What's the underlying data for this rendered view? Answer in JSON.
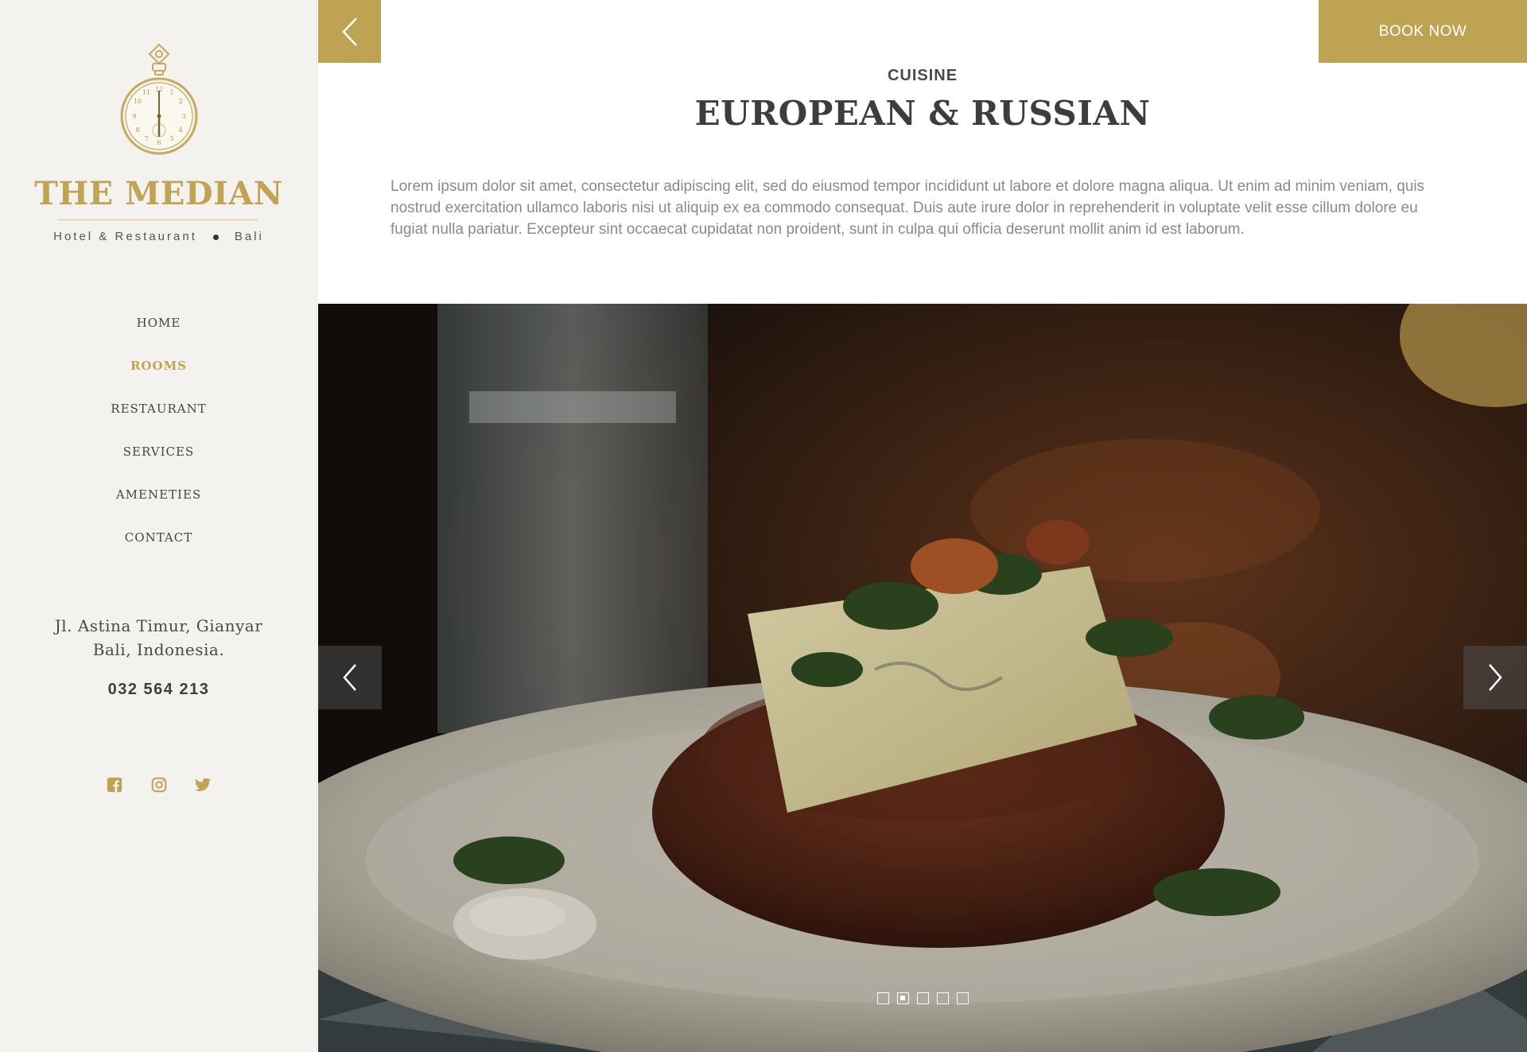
{
  "brand": {
    "name": "THE MEDIAN",
    "tagline_left": "Hotel & Restaurant",
    "tagline_right": "Bali"
  },
  "nav": {
    "items": [
      {
        "label": "HOME",
        "active": false
      },
      {
        "label": "ROOMS",
        "active": true
      },
      {
        "label": "RESTAURANT",
        "active": false
      },
      {
        "label": "SERVICES",
        "active": false
      },
      {
        "label": "AMENETIES",
        "active": false
      },
      {
        "label": "CONTACT",
        "active": false
      }
    ]
  },
  "contact": {
    "address_line1": "Jl. Astina Timur, Gianyar",
    "address_line2": "Bali, Indonesia.",
    "phone": "032 564 213"
  },
  "socials": [
    "facebook-icon",
    "instagram-icon",
    "twitter-icon"
  ],
  "header": {
    "book_label": "BOOK NOW",
    "back_icon": "chevron-left-icon"
  },
  "content": {
    "kicker": "CUISINE",
    "title": "EUROPEAN & RUSSIAN",
    "description": "Lorem ipsum dolor sit amet, consectetur adipiscing elit, sed do eiusmod tempor incididunt ut labore et dolore magna aliqua. Ut enim ad minim veniam, quis nostrud exercitation ullamco laboris nisi ut aliquip ex ea commodo consequat. Duis aute irure dolor in reprehenderit in voluptate velit esse cillum dolore eu fugiat nulla pariatur. Excepteur sint occaecat cupidatat non proident, sunt in culpa qui officia deserunt mollit anim id est laborum."
  },
  "slider": {
    "slide_count": 5,
    "active_index": 1
  },
  "colors": {
    "accent": "#bfa354",
    "sidebar_bg": "#f4f2ef"
  }
}
